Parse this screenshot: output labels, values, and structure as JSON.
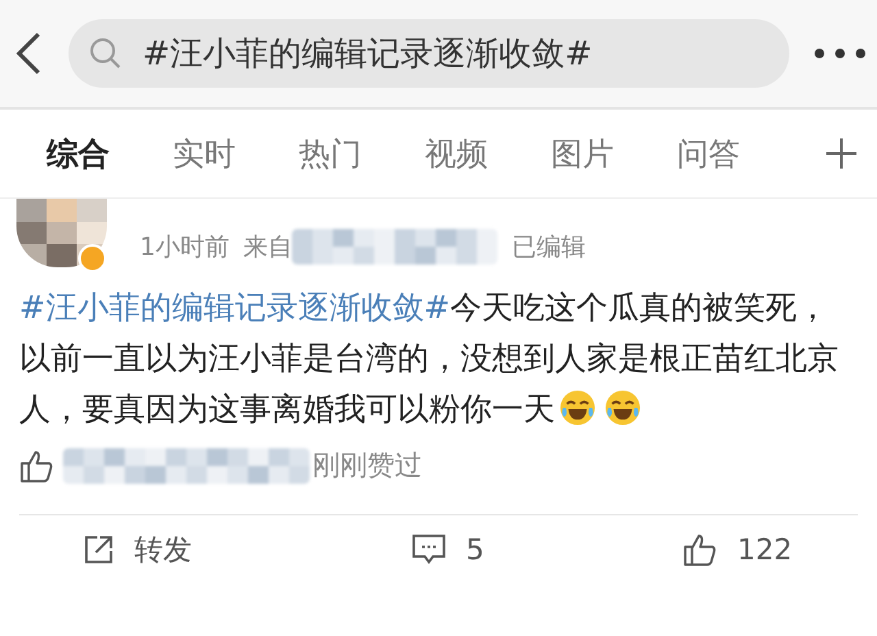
{
  "header": {
    "search": {
      "value": "#汪小菲的编辑记录逐渐收敛#"
    }
  },
  "tabs": [
    {
      "label": "综合",
      "selected": true
    },
    {
      "label": "实时",
      "selected": false
    },
    {
      "label": "热门",
      "selected": false
    },
    {
      "label": "视频",
      "selected": false
    },
    {
      "label": "图片",
      "selected": false
    },
    {
      "label": "问答",
      "selected": false
    }
  ],
  "post": {
    "time": "1小时前",
    "source_prefix": "来自",
    "edited": "已编辑",
    "hashtag": "#汪小菲的编辑记录逐渐收敛#",
    "text": "今天吃这个瓜真的被笑死，以前一直以为汪小菲是台湾的，没想到人家是根正苗红北京人，要真因为这事离婚我可以粉你一天",
    "liked_by": "刚刚赞过",
    "actions": [
      {
        "kind": "repost",
        "label": "转发"
      },
      {
        "kind": "comment",
        "label": "5"
      },
      {
        "kind": "like",
        "label": "122"
      }
    ]
  }
}
